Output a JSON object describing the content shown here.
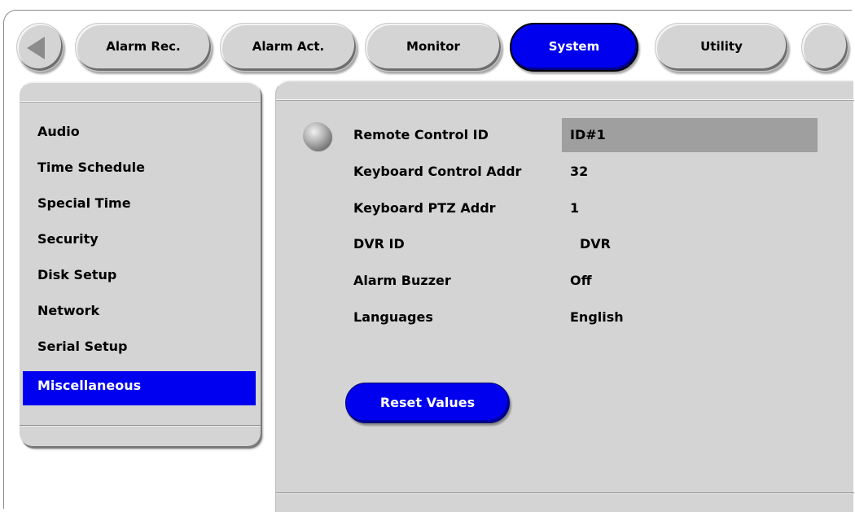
{
  "tabs": [
    {
      "label": "Alarm Rec.",
      "active": false
    },
    {
      "label": "Alarm Act.",
      "active": false
    },
    {
      "label": "Monitor",
      "active": false
    },
    {
      "label": "System",
      "active": true
    },
    {
      "label": "Utility",
      "active": false
    }
  ],
  "nav": {
    "back_icon": "left-arrow-icon",
    "extra_button": "circle-button"
  },
  "sidebar": {
    "items": [
      {
        "label": "Audio"
      },
      {
        "label": "Time Schedule"
      },
      {
        "label": "Special Time"
      },
      {
        "label": "Security"
      },
      {
        "label": "Disk Setup"
      },
      {
        "label": "Network"
      },
      {
        "label": "Serial Setup"
      },
      {
        "label": "Miscellaneous",
        "selected": true
      }
    ]
  },
  "settings": [
    {
      "label": "Remote Control ID",
      "value": "ID#1",
      "focused": true
    },
    {
      "label": "Keyboard Control Addr",
      "value": "32"
    },
    {
      "label": "Keyboard PTZ Addr",
      "value": "1"
    },
    {
      "label": "DVR ID",
      "value": "DVR"
    },
    {
      "label": "Alarm Buzzer",
      "value": "Off"
    },
    {
      "label": "Languages",
      "value": "English"
    }
  ],
  "actions": {
    "reset_label": "Reset Values"
  },
  "colors": {
    "accent": "#0000ee",
    "panel": "#d4d4d4",
    "highlight": "#9f9f9f"
  }
}
